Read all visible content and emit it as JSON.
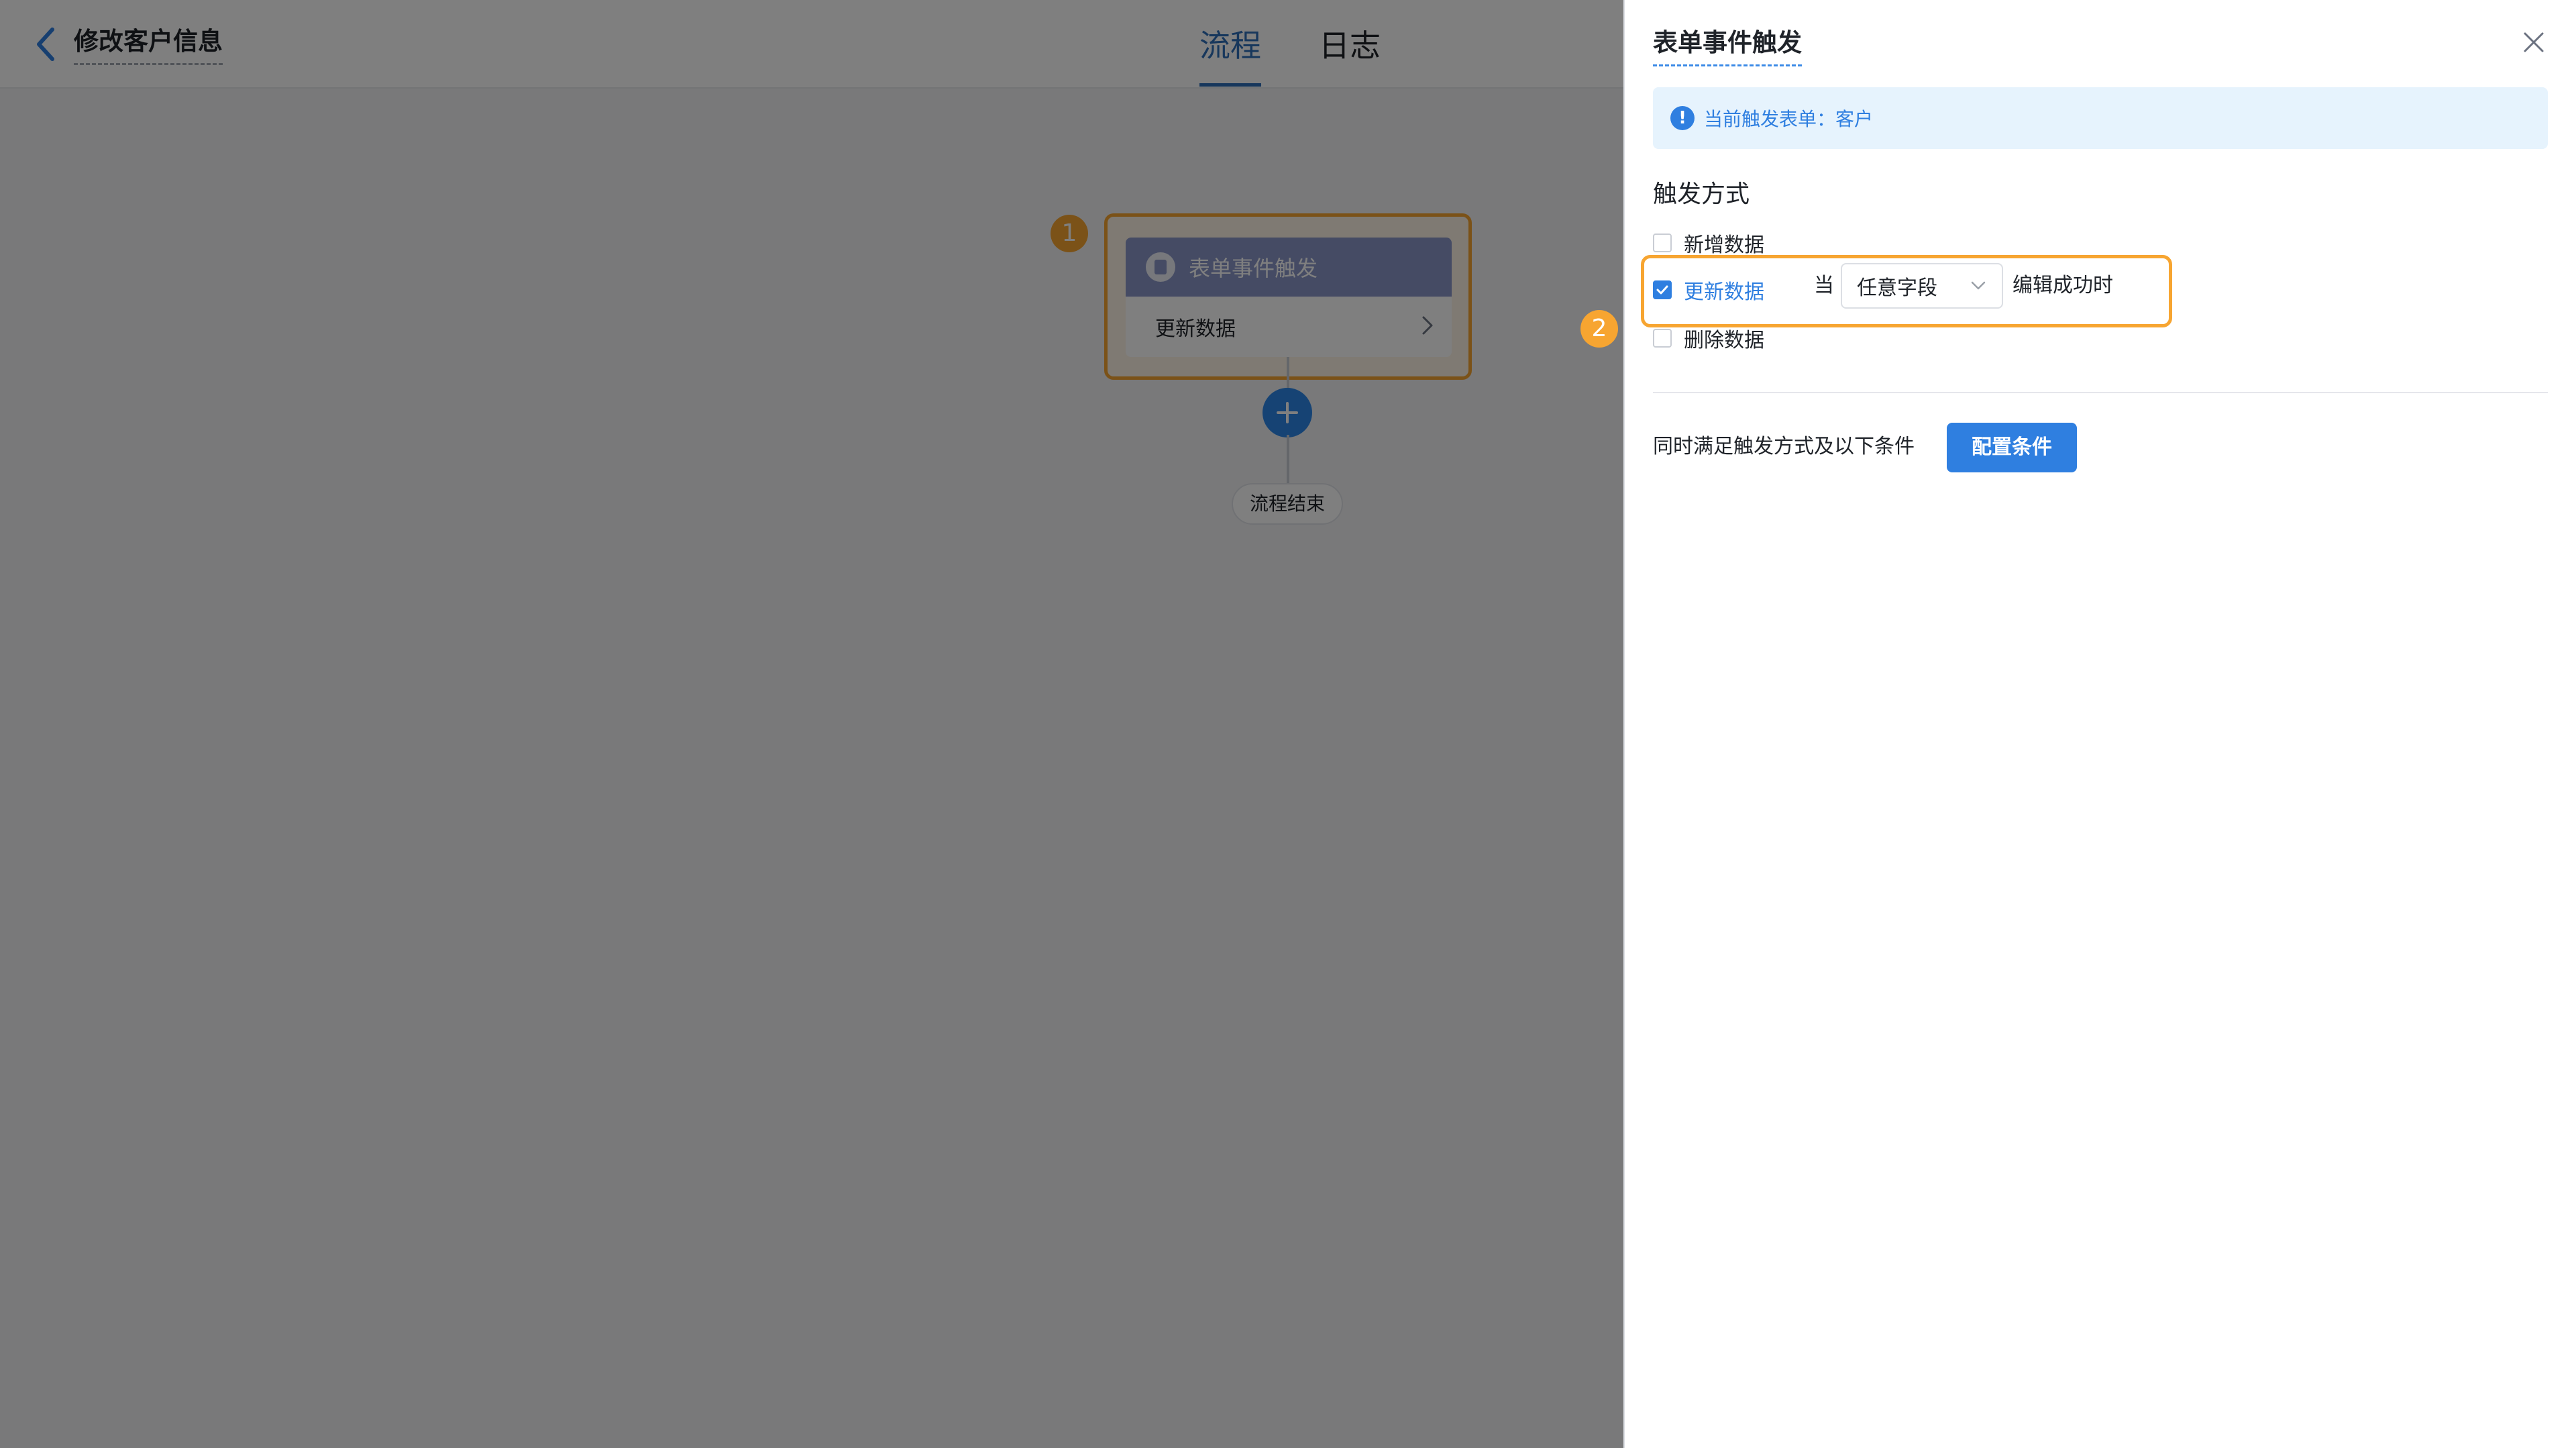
{
  "header": {
    "page_title": "修改客户信息",
    "tabs": [
      {
        "label": "流程",
        "active": true
      },
      {
        "label": "日志",
        "active": false
      }
    ]
  },
  "flow": {
    "steps": [
      "1",
      "2"
    ],
    "trigger_node": {
      "title": "表单事件触发",
      "subtitle": "更新数据"
    },
    "end_node": "流程结束"
  },
  "drawer": {
    "title": "表单事件触发",
    "info": "当前触发表单：客户",
    "trigger_mode_label": "触发方式",
    "options": [
      {
        "label": "新增数据",
        "checked": false
      },
      {
        "label": "更新数据",
        "checked": true
      },
      {
        "label": "删除数据",
        "checked": false
      }
    ],
    "update_condition": {
      "when": "当",
      "field_select": "任意字段",
      "after": "编辑成功时"
    },
    "condition_text": "同时满足触发方式及以下条件",
    "config_button": "配置条件"
  },
  "colors": {
    "accent": "#2f7fe0",
    "highlight": "#f7a531",
    "node_header": "#8b97c9"
  },
  "icons": [
    "back-arrow-icon",
    "form-doc-icon",
    "chevron-right-icon",
    "plus-icon",
    "close-icon",
    "info-icon",
    "check-icon",
    "chevron-down-icon"
  ]
}
